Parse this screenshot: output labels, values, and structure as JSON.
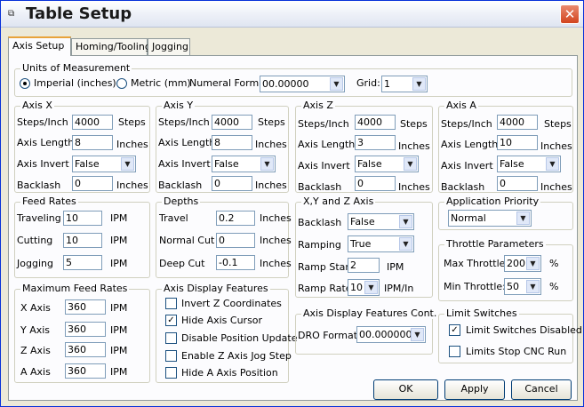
{
  "window": {
    "title": "Table Setup",
    "icon": "app-icon",
    "close_icon": "close-icon"
  },
  "tabs": [
    "Axis Setup",
    "Homing/Tooling",
    "Jogging"
  ],
  "units": {
    "title": "Units of Measurement",
    "imperial": "Imperial (inches)",
    "metric": "Metric (mm)",
    "selected": "Imperial (inches)",
    "numeral_format_label": "Numeral Format:",
    "numeral_format": "00.00000",
    "grid_label": "Grid:",
    "grid": "1"
  },
  "axes": [
    {
      "title": "Axis X",
      "steps_label": "Steps/Inch",
      "steps": "4000",
      "steps_unit": "Steps",
      "length_label": "Axis Length",
      "length": "8",
      "length_unit": "Inches",
      "invert_label": "Axis Invert",
      "invert": "False",
      "backlash_label": "Backlash",
      "backlash": "0",
      "backlash_unit": "Inches"
    },
    {
      "title": "Axis Y",
      "steps_label": "Steps/Inch",
      "steps": "4000",
      "steps_unit": "Steps",
      "length_label": "Axis Length",
      "length": "8",
      "length_unit": "Inches",
      "invert_label": "Axis Invert",
      "invert": "False",
      "backlash_label": "Backlash",
      "backlash": "0",
      "backlash_unit": "Inches"
    },
    {
      "title": "Axis Z",
      "steps_label": "Steps/Inch",
      "steps": "4000",
      "steps_unit": "Steps",
      "length_label": "Axis Length",
      "length": "3",
      "length_unit": "Inches",
      "invert_label": "Axis Invert",
      "invert": "False",
      "backlash_label": "Backlash",
      "backlash": "0",
      "backlash_unit": "Inches"
    },
    {
      "title": "Axis A",
      "steps_label": "Steps/Inch",
      "steps": "4000",
      "steps_unit": "Steps",
      "length_label": "Axis Length",
      "length": "10",
      "length_unit": "Inches",
      "invert_label": "Axis Invert",
      "invert": "False",
      "backlash_label": "Backlash",
      "backlash": "0",
      "backlash_unit": "Inches"
    }
  ],
  "feed_rates": {
    "title": "Feed Rates",
    "rows": [
      {
        "label": "Traveling",
        "value": "10",
        "unit": "IPM"
      },
      {
        "label": "Cutting",
        "value": "10",
        "unit": "IPM"
      },
      {
        "label": "Jogging",
        "value": "5",
        "unit": "IPM"
      }
    ]
  },
  "depths": {
    "title": "Depths",
    "rows": [
      {
        "label": "Travel",
        "value": "0.2",
        "unit": "Inches"
      },
      {
        "label": "Normal Cut",
        "value": "0",
        "unit": "Inches"
      },
      {
        "label": "Deep Cut",
        "value": "-0.1",
        "unit": "Inches"
      }
    ]
  },
  "xyz": {
    "title": "X,Y and Z Axis",
    "backlash_label": "Backlash",
    "backlash": "False",
    "ramping_label": "Ramping",
    "ramping": "True",
    "ramp_start_label": "Ramp Start",
    "ramp_start": "2",
    "ramp_start_unit": "IPM",
    "ramp_rate_label": "Ramp Rate",
    "ramp_rate": "10",
    "ramp_rate_unit": "IPM/In"
  },
  "priority": {
    "title": "Application Priority",
    "value": "Normal"
  },
  "throttle": {
    "title": "Throttle Parameters",
    "max_label": "Max Throttle:",
    "max": "200",
    "max_unit": "%",
    "min_label": "Min Throttle:",
    "min": "50",
    "min_unit": "%"
  },
  "max_feed": {
    "title": "Maximum Feed Rates",
    "rows": [
      {
        "label": "X Axis",
        "value": "360",
        "unit": "IPM"
      },
      {
        "label": "Y Axis",
        "value": "360",
        "unit": "IPM"
      },
      {
        "label": "Z Axis",
        "value": "360",
        "unit": "IPM"
      },
      {
        "label": "A Axis",
        "value": "360",
        "unit": "IPM"
      }
    ]
  },
  "display_features": {
    "title": "Axis Display Features",
    "items": [
      {
        "label": "Invert Z Coordinates",
        "checked": false
      },
      {
        "label": "Hide Axis Cursor",
        "checked": true
      },
      {
        "label": "Disable Position Update",
        "checked": false
      },
      {
        "label": "Enable Z Axis Jog Step",
        "checked": false
      },
      {
        "label": "Hide A Axis Position",
        "checked": false
      }
    ]
  },
  "display_cont": {
    "title": "Axis Display Features Cont.",
    "dro_label": "DRO Format",
    "dro": "00.000000"
  },
  "limit_switches": {
    "title": "Limit Switches",
    "items": [
      {
        "label": "Limit Switches Disabled",
        "checked": true
      },
      {
        "label": "Limits Stop CNC Run",
        "checked": false
      }
    ]
  },
  "buttons": {
    "ok": "OK",
    "apply": "Apply",
    "cancel": "Cancel"
  },
  "check_mark": "✓",
  "dropdown_arrow": "▼"
}
